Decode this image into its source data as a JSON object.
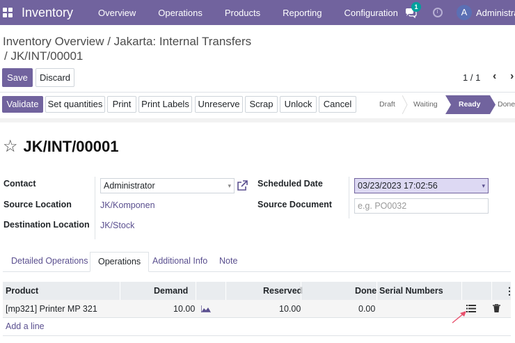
{
  "navbar": {
    "brand": "Inventory",
    "menu": [
      "Overview",
      "Operations",
      "Products",
      "Reporting",
      "Configuration"
    ],
    "chat_badge": "1",
    "avatar_letter": "A",
    "user_name": "Administrator"
  },
  "breadcrumb": {
    "part1": "Inventory Overview",
    "separator": " / ",
    "part2": "Jakarta: Internal Transfers",
    "part3": "/ JK/INT/00001"
  },
  "controls": {
    "save": "Save",
    "discard": "Discard",
    "pager": "1 / 1"
  },
  "actions": {
    "validate": "Validate",
    "set_quantities": "Set quantities",
    "print": "Print",
    "print_labels": "Print Labels",
    "unreserve": "Unreserve",
    "scrap": "Scrap",
    "unlock": "Unlock",
    "cancel": "Cancel"
  },
  "status": {
    "stages": [
      "Draft",
      "Waiting",
      "Ready",
      "Done"
    ],
    "active": "Ready"
  },
  "record": {
    "title": "JK/INT/00001"
  },
  "fields": {
    "contact_label": "Contact",
    "contact_value": "Administrator",
    "source_location_label": "Source Location",
    "source_location_value": "JK/Komponen",
    "destination_location_label": "Destination Location",
    "destination_location_value": "JK/Stock",
    "scheduled_date_label": "Scheduled Date",
    "scheduled_date_value": "03/23/2023 17:02:56",
    "source_document_label": "Source Document",
    "source_document_placeholder": "e.g. PO0032"
  },
  "tabs": [
    "Detailed Operations",
    "Operations",
    "Additional Info",
    "Note"
  ],
  "active_tab": "Operations",
  "table": {
    "headers": {
      "product": "Product",
      "demand": "Demand",
      "reserved": "Reserved",
      "done": "Done",
      "serial": "Serial Numbers"
    },
    "rows": [
      {
        "product": "[mp321] Printer MP 321",
        "demand": "10.00",
        "reserved": "10.00",
        "done": "0.00"
      }
    ],
    "add_line": "Add a line"
  },
  "colors": {
    "brand": "#71639e",
    "link": "#5a4f8f",
    "badge": "#00a09d"
  }
}
